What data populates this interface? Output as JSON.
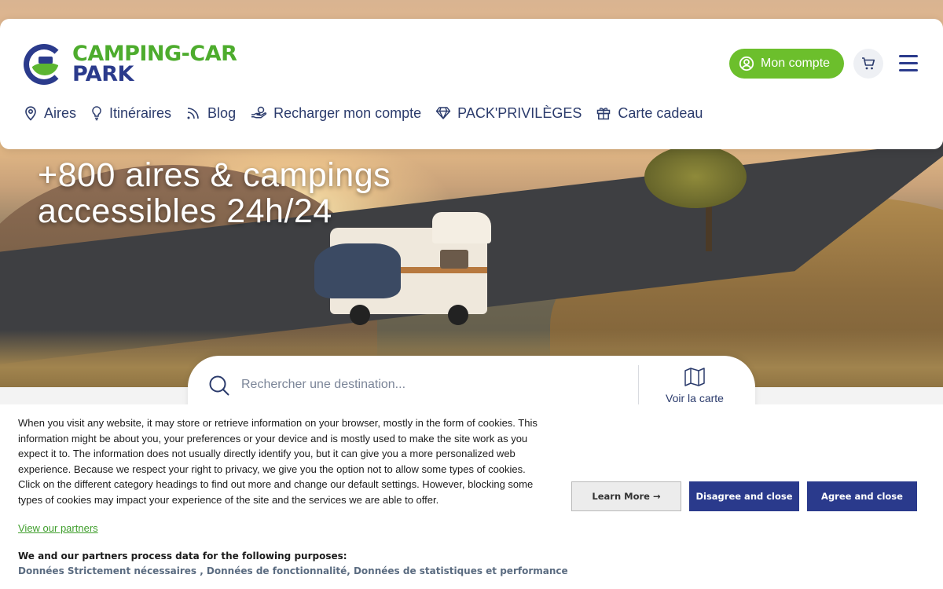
{
  "brand": {
    "line1": "CAMPING-CAR",
    "line2": "PARK"
  },
  "header": {
    "account_label": "Mon compte",
    "nav": [
      {
        "label": "Aires",
        "icon": "location-pin-icon"
      },
      {
        "label": "Itinéraires",
        "icon": "lightbulb-icon"
      },
      {
        "label": "Blog",
        "icon": "rss-icon"
      },
      {
        "label": "Recharger mon compte",
        "icon": "hand-coin-icon"
      },
      {
        "label": "PACK'PRIVILÈGES",
        "icon": "diamond-icon"
      },
      {
        "label": "Carte cadeau",
        "icon": "gift-icon"
      }
    ]
  },
  "hero": {
    "title_line1": "+800 aires & campings",
    "title_line2": "accessibles 24h/24"
  },
  "search": {
    "placeholder": "Rechercher une destination...",
    "map_label": "Voir la carte"
  },
  "cookie": {
    "text": "When you visit any website, it may store or retrieve information on your browser, mostly in the form of cookies. This information might be about you, your preferences or your device and is mostly used to make the site work as you expect it to. The information does not usually directly identify you, but it can give you a more personalized web experience. Because we respect your right to privacy, we give you the option not to allow some types of cookies. Click on the different category headings to find out more and change our default settings. However, blocking some types of cookies may impact your experience of the site and the services we are able to offer.",
    "partners_link": "View our partners",
    "purposes_heading": "We and our partners process data for the following purposes:",
    "purposes": "Données Strictement nécessaires , Données de fonctionnalité, Données de statistiques et performance",
    "learn_more": "Learn More →",
    "disagree": "Disagree and close",
    "agree": "Agree and close"
  },
  "colors": {
    "brand_green": "#4dac2d",
    "brand_blue": "#2b3b8c",
    "button_green": "#6cbf2c"
  }
}
